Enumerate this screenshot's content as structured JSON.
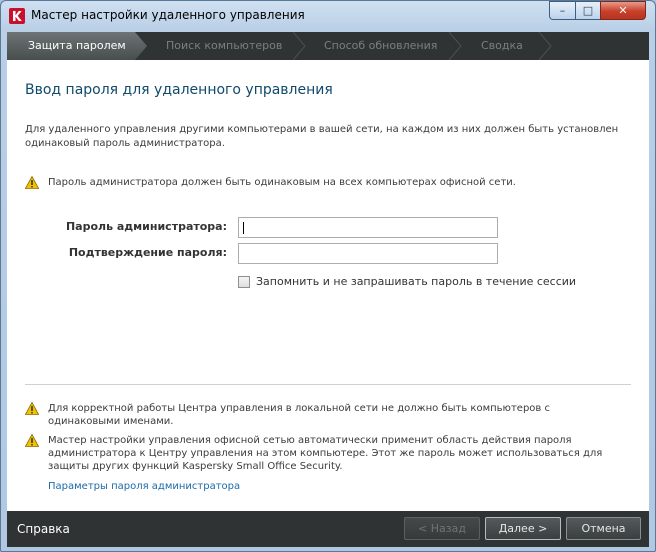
{
  "window": {
    "title": "Мастер настройки удаленного управления",
    "controls": {
      "minimize": "–",
      "maximize": "□",
      "close": "✕"
    }
  },
  "tabs": [
    {
      "label": "Защита паролем",
      "active": true
    },
    {
      "label": "Поиск компьютеров",
      "active": false
    },
    {
      "label": "Способ обновления",
      "active": false
    },
    {
      "label": "Сводка",
      "active": false
    }
  ],
  "content": {
    "heading": "Ввод пароля для удаленного управления",
    "intro": "Для удаленного управления другими компьютерами в вашей сети, на каждом из них должен быть установлен одинаковый пароль администратора.",
    "warning_top": "Пароль администратора должен быть одинаковым на всех компьютерах офисной сети.",
    "form": {
      "password_label": "Пароль администратора:",
      "password_value": "",
      "confirm_label": "Подтверждение пароля:",
      "confirm_value": "",
      "remember_label": "Запомнить и не запрашивать пароль в течение сессии",
      "remember_checked": false
    },
    "notes": [
      "Для корректной работы Центра управления в локальной сети не должно быть компьютеров с одинаковыми именами.",
      "Мастер настройки управления офисной сетью автоматически применит область действия пароля администратора к Центру управления на этом компьютере. Этот же пароль может использоваться для защиты других функций Kaspersky Small Office Security."
    ],
    "link": "Параметры пароля администратора"
  },
  "footer": {
    "help": "Справка",
    "back": "< Назад",
    "next": "Далее >",
    "cancel": "Отмена"
  },
  "colors": {
    "accent_heading": "#0f4a6b",
    "link": "#1c6aa8",
    "dark_bar": "#2f3334",
    "warning": "#f2c200",
    "brand_red": "#c8102e"
  },
  "icons": {
    "app": "kaspersky-k-icon",
    "warning": "warning-triangle-icon"
  }
}
